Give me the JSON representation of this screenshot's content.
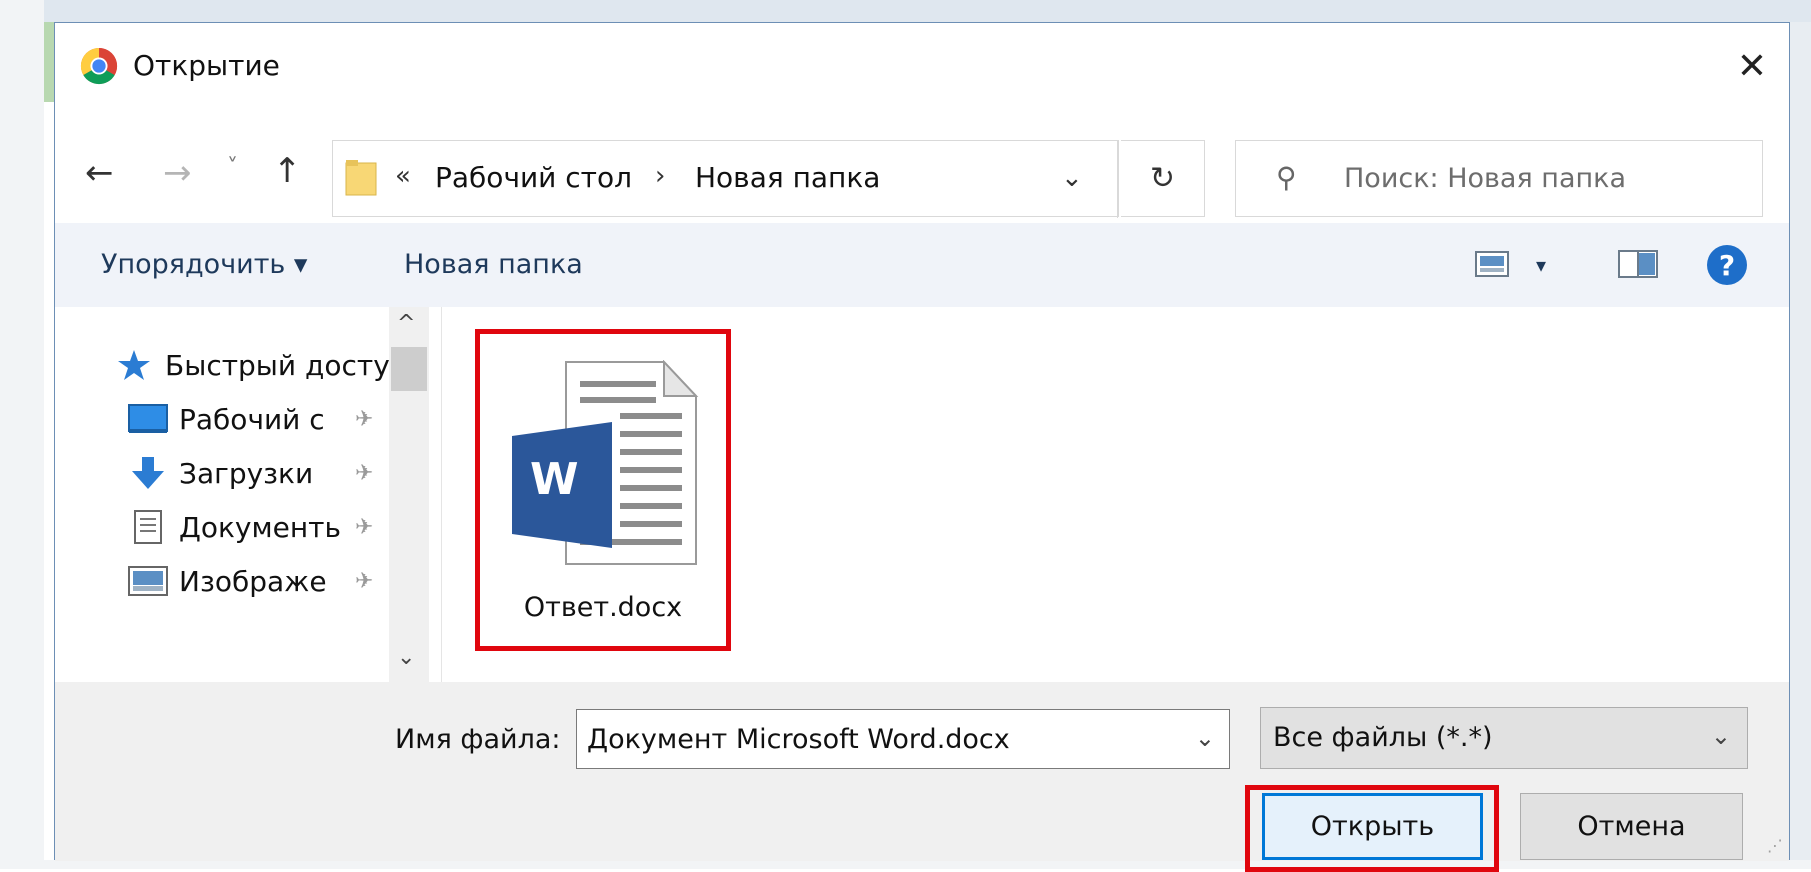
{
  "dialog": {
    "title": "Открытие",
    "close_label": "✕"
  },
  "nav": {
    "back_label": "←",
    "forward_label": "→",
    "recent_label": "˅",
    "up_label": "↑",
    "breadcrumb_overflow": "«",
    "breadcrumb": [
      "Рабочий стол",
      "Новая папка"
    ],
    "breadcrumb_sep": "›",
    "address_dropdown": "⌄",
    "refresh_label": "↻",
    "search_placeholder": "Поиск: Новая папка",
    "search_glyph": "⚲"
  },
  "toolbar": {
    "organize_label": "Упорядочить ▾",
    "new_folder_label": "Новая папка",
    "view_dropdown": "▾",
    "help_label": "?"
  },
  "sidebar": {
    "items": [
      {
        "label": "Быстрый досту",
        "icon": "star-icon",
        "pinned": false
      },
      {
        "label": "Рабочий с",
        "icon": "desktop-icon",
        "pinned": true
      },
      {
        "label": "Загрузки",
        "icon": "download-icon",
        "pinned": true
      },
      {
        "label": "Документь",
        "icon": "document-icon",
        "pinned": true
      },
      {
        "label": "Изображе",
        "icon": "pictures-icon",
        "pinned": true
      }
    ],
    "pin_glyph": "✈",
    "scroll_up": "^",
    "scroll_down": "⌄"
  },
  "files": [
    {
      "name": "Ответ.docx",
      "icon": "word-document-icon",
      "icon_letter": "W",
      "selected": true
    }
  ],
  "bottom": {
    "filename_label": "Имя файла:",
    "filename_value": "Документ Microsoft Word.docx",
    "filename_dropdown": "⌄",
    "filetype_value": "Все файлы (*.*)",
    "filetype_dropdown": "⌄",
    "open_label": "Открыть",
    "cancel_label": "Отмена",
    "grip": "⋰"
  },
  "colors": {
    "highlight": "#e0060e",
    "accent": "#0078d7",
    "word_blue": "#2b579a",
    "link_text": "#1e395b"
  }
}
